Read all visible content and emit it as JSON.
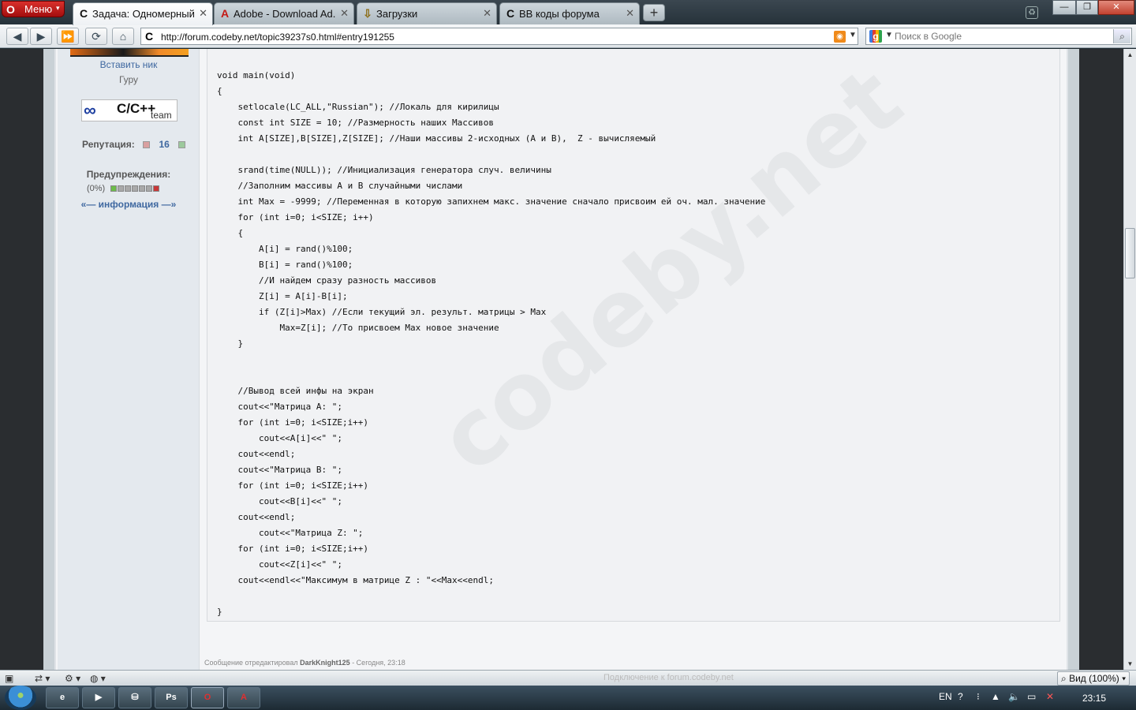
{
  "browser": {
    "menu_label": "Меню",
    "tabs": [
      {
        "title": "Задача: Одномерный ...",
        "active": true,
        "icon": "codeby-c-icon"
      },
      {
        "title": "Adobe - Download Ad...",
        "active": false,
        "icon": "adobe-icon"
      },
      {
        "title": "Загрузки",
        "active": false,
        "icon": "download-icon"
      },
      {
        "title": "BB коды форума",
        "active": false,
        "icon": "codeby-c-icon"
      }
    ],
    "url": "http://forum.codeby.net/topic39237s0.html#entry191255",
    "search_placeholder": "Поиск в Google"
  },
  "user_panel": {
    "insert_nick": "Вставить ник",
    "rank": "Гуру",
    "team_badge": {
      "text": "C/C++",
      "sub": "team"
    },
    "reputation_label": "Репутация:",
    "reputation_value": "16",
    "warnings_label": "Предупреждения:",
    "warnings_percent": "(0%)",
    "info_link": "«— информация —»"
  },
  "post": {
    "code_lines": [
      "void main(void)",
      "{",
      "    setlocale(LC_ALL,\"Russian\"); //Локаль для кирилицы",
      "    const int SIZE = 10; //Размерность наших Массивов",
      "    int A[SIZE],B[SIZE],Z[SIZE]; //Наши массивы 2-исходных (A и B),  Z - вычисляемый",
      "",
      "    srand(time(NULL)); //Инициализация генератора случ. величины",
      "    //Заполним массивы А и В случайными числами",
      "    int Max = -9999; //Переменная в которую запихнем макс. значение сначало присвоим ей оч. мал. значение",
      "    for (int i=0; i<SIZE; i++)",
      "    {",
      "        A[i] = rand()%100;",
      "        B[i] = rand()%100;",
      "        //И найдем сразу разность массивов",
      "        Z[i] = A[i]-B[i];",
      "        if (Z[i]>Max) //Если текущий эл. результ. матрицы > Max",
      "            Max=Z[i]; //То присвоем Max новое значение",
      "    }",
      "",
      "",
      "    //Вывод всей инфы на экран",
      "    cout<<\"Матрица A: \";",
      "    for (int i=0; i<SIZE;i++)",
      "        cout<<A[i]<<\" \";",
      "    cout<<endl;",
      "    cout<<\"Матрица B: \";",
      "    for (int i=0; i<SIZE;i++)",
      "        cout<<B[i]<<\" \";",
      "    cout<<endl;",
      "        cout<<\"Матрица Z: \";",
      "    for (int i=0; i<SIZE;i++)",
      "        cout<<Z[i]<<\" \";",
      "    cout<<endl<<\"Максимум в матрице Z : \"<<Max<<endl;",
      "",
      "}"
    ],
    "watermark": "codeby.net",
    "edit_prefix": "Сообщение отредактировал",
    "edit_author": "DarkKnight125",
    "edit_time": "- Сегодня, 23:18"
  },
  "statusbar": {
    "message": "Подключение к forum.codeby.net",
    "zoom": "Вид (100%)"
  },
  "taskbar": {
    "language": "EN",
    "time": "23:15"
  },
  "colors": {
    "link": "#3f68a0",
    "opera_red": "#c41a16"
  }
}
